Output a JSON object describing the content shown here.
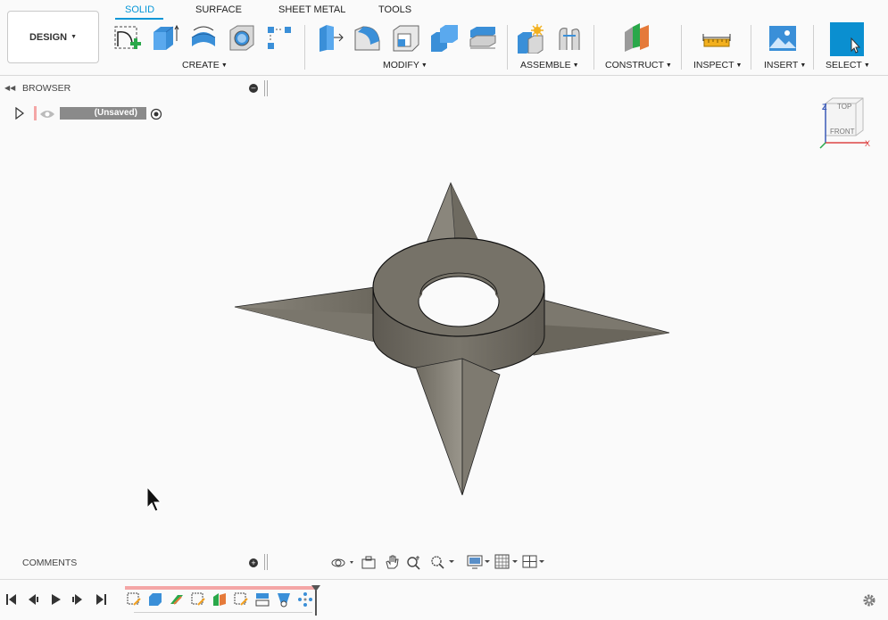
{
  "toolbar": {
    "workspace_label": "DESIGN",
    "tabs": [
      {
        "label": "SOLID"
      },
      {
        "label": "SURFACE"
      },
      {
        "label": "SHEET METAL"
      },
      {
        "label": "TOOLS"
      }
    ],
    "groups": {
      "create": "CREATE",
      "modify": "MODIFY",
      "assemble": "ASSEMBLE",
      "construct": "CONSTRUCT",
      "inspect": "INSPECT",
      "insert": "INSERT",
      "select": "SELECT"
    }
  },
  "browser": {
    "title": "BROWSER",
    "document_name": "(Unsaved)"
  },
  "comments": {
    "title": "COMMENTS"
  },
  "viewcube": {
    "top": "TOP",
    "front": "FRONT",
    "axis_x": "X",
    "axis_z": "Z"
  },
  "colors": {
    "accent": "#0696d7",
    "model_fill": "#7a766c",
    "model_edge": "#1a1a1a",
    "timeline_bar": "#f4a6a6"
  }
}
